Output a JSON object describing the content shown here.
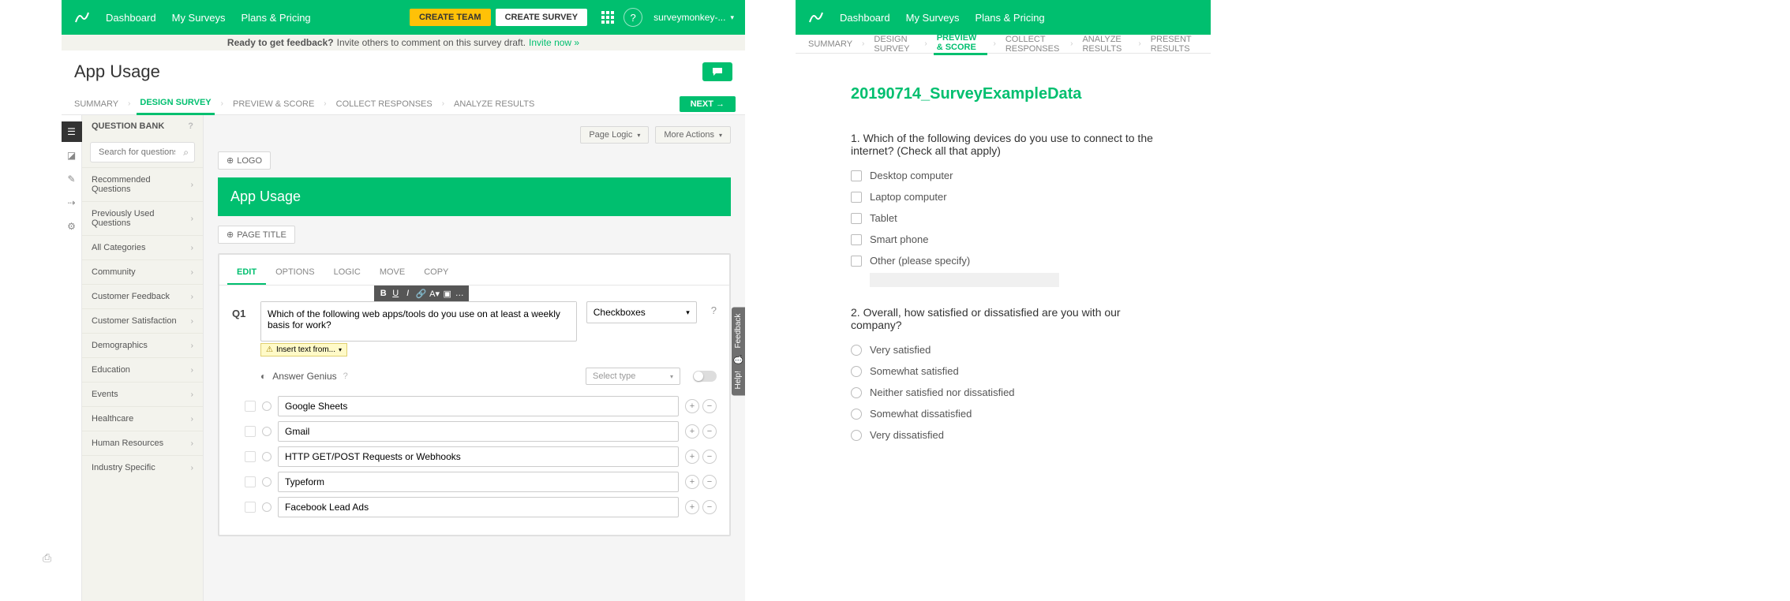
{
  "topbar": {
    "nav": [
      "Dashboard",
      "My Surveys",
      "Plans & Pricing"
    ],
    "create_team": "CREATE TEAM",
    "create_survey": "CREATE SURVEY",
    "account": "surveymonkey-..."
  },
  "banner": {
    "bold": "Ready to get feedback?",
    "text": "Invite others to comment on this survey draft.",
    "link": "Invite now »"
  },
  "left": {
    "survey_title": "App Usage",
    "tabs": [
      "SUMMARY",
      "DESIGN SURVEY",
      "PREVIEW & SCORE",
      "COLLECT RESPONSES",
      "ANALYZE RESULTS"
    ],
    "active_tab": 1,
    "next": "NEXT",
    "sidebar": {
      "header": "QUESTION BANK",
      "search_placeholder": "Search for questions",
      "items": [
        "Recommended Questions",
        "Previously Used Questions",
        "All Categories",
        "Community",
        "Customer Feedback",
        "Customer Satisfaction",
        "Demographics",
        "Education",
        "Events",
        "Healthcare",
        "Human Resources",
        "Industry Specific"
      ]
    },
    "page_controls": {
      "page_logic": "Page Logic",
      "more_actions": "More Actions"
    },
    "logo_btn": "LOGO",
    "page_title_banner": "App Usage",
    "add_page_title": "PAGE TITLE",
    "editor": {
      "tabs": [
        "EDIT",
        "OPTIONS",
        "LOGIC",
        "MOVE",
        "COPY"
      ],
      "active_tab": 0,
      "qnum": "Q1",
      "question_text": "Which of the following web apps/tools do you use on at least a weekly basis for work?",
      "insert_from": "Insert text from...",
      "type": "Checkboxes",
      "answer_genius": "Answer Genius",
      "select_type": "Select type",
      "choices": [
        "Google Sheets",
        "Gmail",
        "HTTP GET/POST Requests or Webhooks",
        "Typeform",
        "Facebook Lead Ads"
      ]
    },
    "feedback": {
      "help": "Help!",
      "feedback": "Feedback"
    }
  },
  "right": {
    "tabs": [
      "SUMMARY",
      "DESIGN SURVEY",
      "PREVIEW & SCORE",
      "COLLECT RESPONSES",
      "ANALYZE RESULTS",
      "PRESENT RESULTS"
    ],
    "active_tab": 2,
    "preview_title": "20190714_SurveyExampleData",
    "q1": {
      "text": "1. Which of the following devices do you use to connect to the internet? (Check all that apply)",
      "options": [
        "Desktop computer",
        "Laptop computer",
        "Tablet",
        "Smart phone",
        "Other (please specify)"
      ]
    },
    "q2": {
      "text": "2. Overall, how satisfied or dissatisfied are you with our company?",
      "options": [
        "Very satisfied",
        "Somewhat satisfied",
        "Neither satisfied nor dissatisfied",
        "Somewhat dissatisfied",
        "Very dissatisfied"
      ]
    }
  }
}
